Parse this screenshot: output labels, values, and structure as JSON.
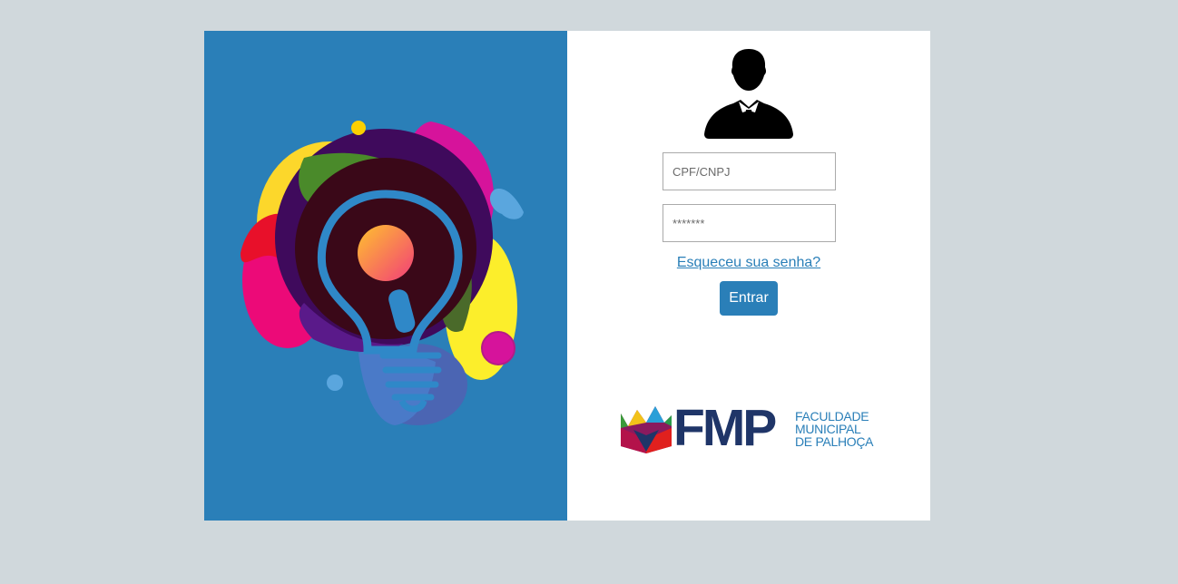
{
  "login": {
    "cpf_placeholder": "CPF/CNPJ",
    "password_placeholder": "*******",
    "forgot_link": "Esqueceu sua senha?",
    "submit_label": "Entrar"
  },
  "logo": {
    "abbr": "FMP",
    "line1": "FACULDADE",
    "line2": "MUNICIPAL",
    "line3": "DE PALHOÇA"
  },
  "icons": {
    "illustration": "lightbulb-illustration",
    "avatar": "user-avatar-icon",
    "logo_mark": "book-logo-icon"
  },
  "colors": {
    "background": "#d0d8dc",
    "left_panel": "#2a7fb8",
    "accent": "#2a7fb8",
    "logo_text": "#1f3568"
  }
}
